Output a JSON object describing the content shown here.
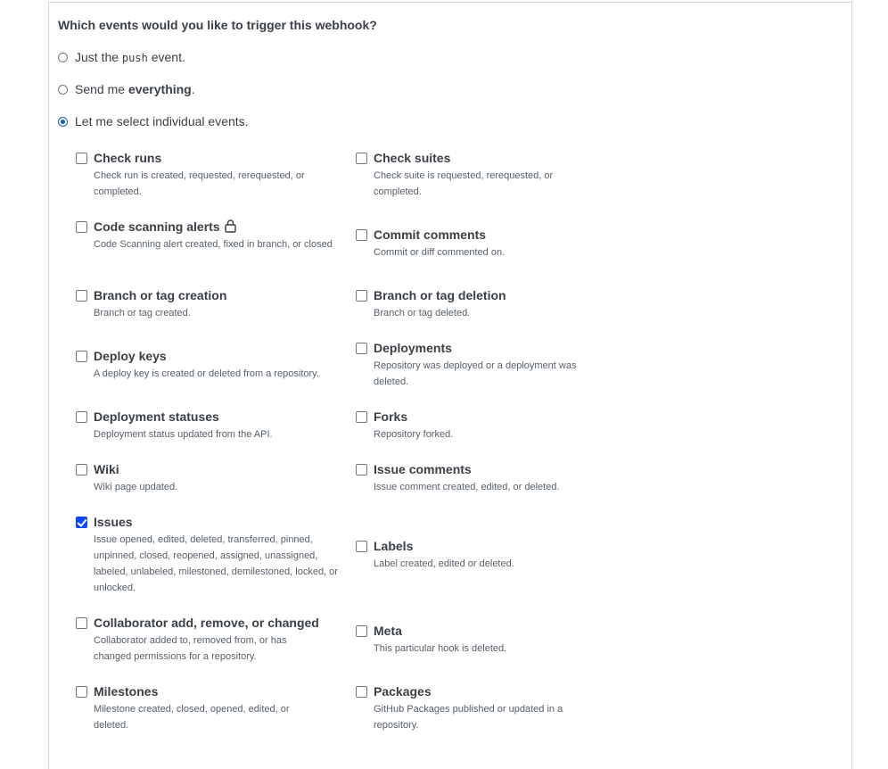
{
  "question": "Which events would you like to trigger this webhook?",
  "options": {
    "push_prefix": "Just the",
    "push_code": "push",
    "push_suffix": "event.",
    "everything_prefix": "Send me",
    "everything_bold": "everything",
    "everything_suffix": ".",
    "individual": "Let me select individual events.",
    "selected": "individual"
  },
  "events": {
    "check_runs": {
      "title": "Check runs",
      "desc": "Check run is created, requested, rerequested, or completed.",
      "checked": false
    },
    "check_suites": {
      "title": "Check suites",
      "desc": "Check suite is requested, rerequested, or completed.",
      "checked": false
    },
    "code_scanning": {
      "title": "Code scanning alerts",
      "desc": "Code Scanning alert created, fixed in branch, or closed",
      "checked": false,
      "icon": "lock-icon"
    },
    "commit_comments": {
      "title": "Commit comments",
      "desc": "Commit or diff commented on.",
      "checked": false
    },
    "branch_creation": {
      "title": "Branch or tag creation",
      "desc": "Branch or tag created.",
      "checked": false
    },
    "branch_deletion": {
      "title": "Branch or tag deletion",
      "desc": "Branch or tag deleted.",
      "checked": false
    },
    "deploy_keys": {
      "title": "Deploy keys",
      "desc": "A deploy key is created or deleted from a repository.",
      "checked": false
    },
    "deployments": {
      "title": "Deployments",
      "desc": "Repository was deployed or a deployment was deleted.",
      "checked": false
    },
    "deployment_statuses": {
      "title": "Deployment statuses",
      "desc": "Deployment status updated from the API.",
      "checked": false
    },
    "forks": {
      "title": "Forks",
      "desc": "Repository forked.",
      "checked": false
    },
    "wiki": {
      "title": "Wiki",
      "desc": "Wiki page updated.",
      "checked": false
    },
    "issue_comments": {
      "title": "Issue comments",
      "desc": "Issue comment created, edited, or deleted.",
      "checked": false
    },
    "issues": {
      "title": "Issues",
      "desc": "Issue opened, edited, deleted, transferred, pinned, unpinned, closed, reopened, assigned, unassigned, labeled, unlabeled, milestoned, demilestoned, locked, or unlocked.",
      "checked": true
    },
    "labels": {
      "title": "Labels",
      "desc": "Label created, edited or deleted.",
      "checked": false
    },
    "collaborator": {
      "title": "Collaborator add, remove, or changed",
      "desc": "Collaborator added to, removed from, or has changed permissions for a repository.",
      "checked": false
    },
    "meta": {
      "title": "Meta",
      "desc": "This particular hook is deleted.",
      "checked": false
    },
    "milestones": {
      "title": "Milestones",
      "desc": "Milestone created, closed, opened, edited, or deleted.",
      "checked": false
    },
    "packages": {
      "title": "Packages",
      "desc": "GitHub Packages published or updated in a repository.",
      "checked": false
    }
  },
  "colors": {
    "accent": "#0d47f5",
    "radio_selected": "#1a5fb4",
    "text": "#3b4046",
    "muted": "#57606a",
    "border": "#d0d7de"
  }
}
